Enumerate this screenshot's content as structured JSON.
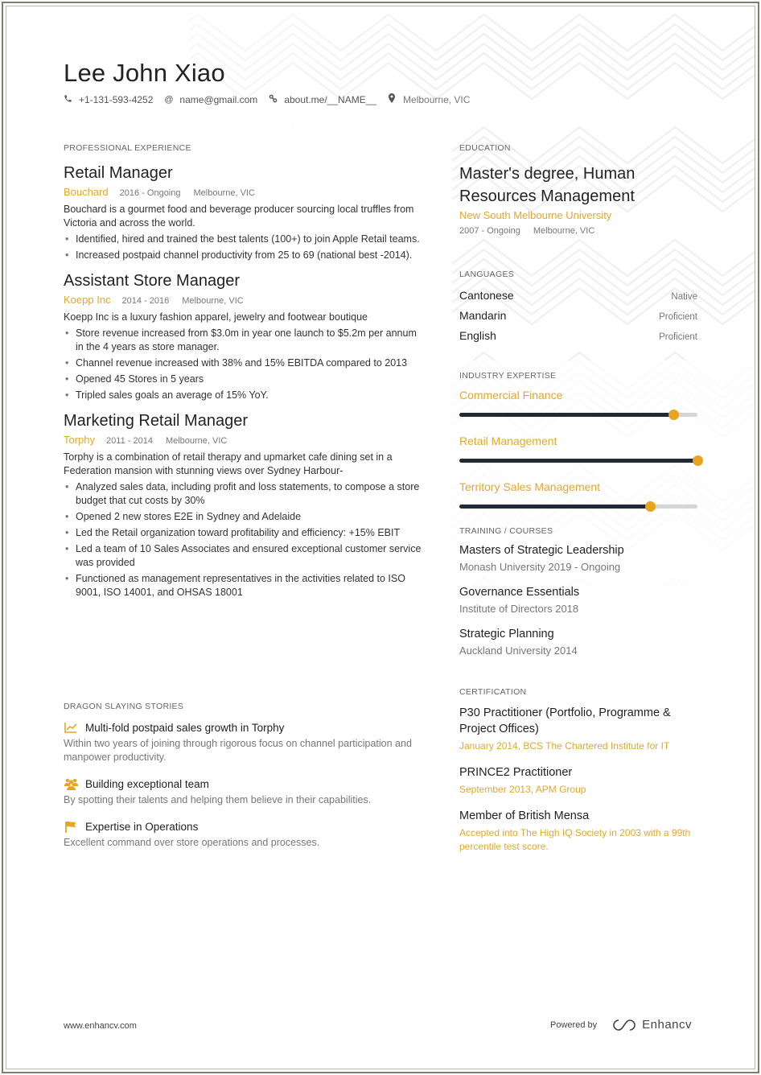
{
  "header": {
    "name": "Lee John Xiao",
    "contacts": [
      {
        "icon": "phone-icon",
        "text": "+1-131-593-4252"
      },
      {
        "icon": "at-icon",
        "text": "name@gmail.com"
      },
      {
        "icon": "link-icon",
        "text": "about.me/__NAME__"
      },
      {
        "icon": "location-pin-icon",
        "text": "Melbourne, VIC"
      }
    ]
  },
  "experience": {
    "section_title": "PROFESSIONAL EXPERIENCE",
    "jobs": [
      {
        "title": "Retail Manager",
        "company": "Bouchard",
        "dates": "2016 - Ongoing",
        "location": "Melbourne, VIC",
        "description": "Bouchard is a gourmet food and beverage producer sourcing local truffles from Victoria and across the world.",
        "bullets": [
          "Identified, hired and trained the best talents (100+) to join Apple Retail teams.",
          "Increased postpaid channel productivity from 25 to 69 (national best -2014)."
        ]
      },
      {
        "title": "Assistant Store Manager",
        "company": "Koepp Inc",
        "dates": "2014 - 2016",
        "location": "Melbourne, VIC",
        "description": "Koepp Inc is a luxury fashion apparel, jewelry and footwear boutique",
        "bullets": [
          "Store revenue increased from $3.0m in year one launch to $5.2m per annum in the 4 years as store manager.",
          "Channel revenue increased with 38% and 15% EBITDA compared to 2013",
          "Opened 45 Stores in 5 years",
          "Tripled sales goals an average of 15% YoY."
        ]
      },
      {
        "title": "Marketing Retail Manager",
        "company": "Torphy",
        "dates": "2011 - 2014",
        "location": "Melbourne, VIC",
        "description": "Torphy is a combination of retail therapy and upmarket cafe dining set in a Federation mansion with stunning views over Sydney Harbour-",
        "bullets": [
          "Analyzed sales data, including profit and loss statements, to compose a store budget that cut costs by 30%",
          "Opened 2 new stores E2E in Sydney and Adelaide",
          "Led the Retail organization toward profitability and efficiency: +15% EBIT",
          "Led a team of 10 Sales Associates and ensured exceptional customer service was provided",
          "Functioned as management representatives in the activities related to ISO 9001, ISO 14001, and OHSAS 18001"
        ]
      }
    ]
  },
  "stories": {
    "section_title": "DRAGON SLAYING STORIES",
    "items": [
      {
        "icon": "chart-line-icon",
        "title": "Multi-fold postpaid sales growth in Torphy",
        "description": "Within two years of joining through rigorous focus on channel participation and manpower productivity."
      },
      {
        "icon": "team-icon",
        "title": "Building exceptional team",
        "description": "By spotting their talents and helping them believe in their capabilities."
      },
      {
        "icon": "flag-icon",
        "title": "Expertise in Operations",
        "description": "Excellent command over store operations and processes."
      }
    ]
  },
  "education": {
    "section_title": "EDUCATION",
    "degree": "Master's degree, Human Resources Management",
    "school": "New South Melbourne University",
    "dates": "2007 - Ongoing",
    "location": "Melbourne, VIC"
  },
  "languages": {
    "section_title": "LANGUAGES",
    "items": [
      {
        "name": "Cantonese",
        "level": "Native"
      },
      {
        "name": "Mandarin",
        "level": "Proficient"
      },
      {
        "name": "English",
        "level": "Proficient"
      }
    ]
  },
  "expertise": {
    "section_title": "INDUSTRY EXPERTISE",
    "items": [
      {
        "name": "Commercial Finance",
        "level": 0.9
      },
      {
        "name": "Retail Management",
        "level": 1.0
      },
      {
        "name": "Territory Sales Management",
        "level": 0.8
      }
    ]
  },
  "training": {
    "section_title": "TRAINING / COURSES",
    "items": [
      {
        "title": "Masters of Strategic Leadership",
        "subtitle": "Monash University 2019 - Ongoing"
      },
      {
        "title": "Governance Essentials",
        "subtitle": "Institute of Directors 2018"
      },
      {
        "title": "Strategic Planning",
        "subtitle": "Auckland University 2014"
      }
    ]
  },
  "certification": {
    "section_title": "CERTIFICATION",
    "items": [
      {
        "title": "P30 Practitioner (Portfolio, Programme & Project Offices)",
        "subtitle": "January 2014, BCS The Chartered Institute for IT"
      },
      {
        "title": "PRINCE2 Practitioner",
        "subtitle": "September 2013, APM Group"
      },
      {
        "title": "Member of British Mensa",
        "subtitle": "Accepted into The High IQ Society in 2003 with a 99th percentile test score."
      }
    ]
  },
  "footer": {
    "website": "www.enhancv.com",
    "powered_by": "Powered by",
    "brand": "Enhancv"
  },
  "colors": {
    "accent": "#e0a82e",
    "knob": "#e8a420",
    "bar_fill": "#1f2937",
    "bar_track": "#d6d6d6",
    "border": "#7b7e70"
  }
}
